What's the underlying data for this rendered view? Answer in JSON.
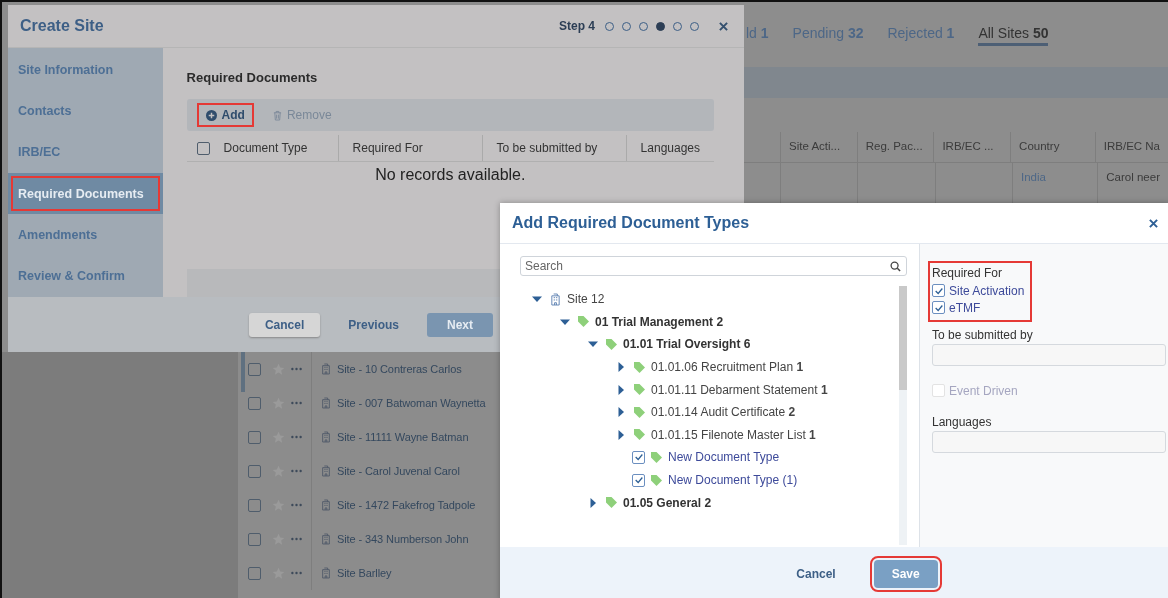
{
  "background_page": {
    "tabs": [
      {
        "label": "ld **1**",
        "selected": false
      },
      {
        "label": "Pending **32**",
        "selected": false
      },
      {
        "label": "Rejected **1**",
        "selected": false
      },
      {
        "label": "All Sites **50**",
        "selected": true
      }
    ],
    "table": {
      "columns": [
        "Site Acti...",
        "Reg. Pac...",
        "IRB/EC ...",
        "Country",
        "IRB/EC Na"
      ],
      "rows": [
        {
          "cells": [
            "",
            "",
            "",
            "India",
            "Carol neer"
          ]
        }
      ]
    },
    "site_list": [
      {
        "name": "Site - 10 Contreras Carlos",
        "checked": false
      },
      {
        "name": "Site - 007 Batwoman Waynetta",
        "checked": false
      },
      {
        "name": "Site - 11111 Wayne Batman",
        "checked": false
      },
      {
        "name": "Site - Carol Juvenal Carol",
        "checked": false
      },
      {
        "name": "Site - 1472 Fakefrog Tadpole",
        "checked": false
      },
      {
        "name": "Site - 343 Numberson John",
        "checked": false
      },
      {
        "name": "Site Barlley",
        "checked": false
      }
    ]
  },
  "create_site": {
    "title": "Create Site",
    "step_label": "Step 4",
    "steps": [
      {
        "selected": false
      },
      {
        "selected": false
      },
      {
        "selected": false
      },
      {
        "selected": true
      },
      {
        "selected": false
      },
      {
        "selected": false
      }
    ],
    "nav": [
      {
        "label": "Site Information",
        "selected": false,
        "highlighted": false
      },
      {
        "label": "Contacts",
        "selected": false,
        "highlighted": false
      },
      {
        "label": "IRB/EC",
        "selected": false,
        "highlighted": false
      },
      {
        "label": "Required Documents",
        "selected": true,
        "highlighted": true
      },
      {
        "label": "Amendments",
        "selected": false,
        "highlighted": false
      },
      {
        "label": "Review & Confirm",
        "selected": false,
        "highlighted": false
      }
    ],
    "section_title": "Required Documents",
    "toolbar": [
      {
        "label": "Add",
        "kind": "add",
        "disabled": false,
        "highlighted": true
      },
      {
        "label": "Remove",
        "kind": "remove",
        "disabled": true,
        "highlighted": false
      }
    ],
    "table": {
      "select_all_checked": false,
      "columns": [
        "Document Type",
        "Required For",
        "To be submitted by",
        "Languages"
      ],
      "empty_message": "No records available."
    },
    "buttons": [
      {
        "label": "Cancel",
        "kind": "secondary"
      },
      {
        "label": "Previous",
        "kind": "link"
      },
      {
        "label": "Next",
        "kind": "primary"
      }
    ]
  },
  "add_dialog": {
    "title": "Add Required Document Types",
    "search": {
      "placeholder": "Search"
    },
    "tree": [
      {
        "label": "Site 12",
        "kind": "site",
        "expanded": true,
        "children": [
          {
            "label": "01 Trial Management 2",
            "kind": "folder",
            "expanded": true,
            "children": [
              {
                "label": "01.01 Trial Oversight 6",
                "kind": "folder",
                "expanded": true,
                "children": [
                  {
                    "label": "01.01.06 Recruitment Plan **1**",
                    "kind": "folder",
                    "expanded": false
                  },
                  {
                    "label": "01.01.11 Debarment Statement **1**",
                    "kind": "folder",
                    "expanded": false
                  },
                  {
                    "label": "01.01.14 Audit Certificate **2**",
                    "kind": "folder",
                    "expanded": false
                  },
                  {
                    "label": "01.01.15 Filenote Master List **1**",
                    "kind": "folder",
                    "expanded": false
                  },
                  {
                    "label": "New Document Type",
                    "kind": "document",
                    "checked": true
                  },
                  {
                    "label": "New Document Type (1)",
                    "kind": "document",
                    "checked": true
                  }
                ]
              },
              {
                "label": "01.05 General **2**",
                "kind": "folder",
                "expanded": false
              }
            ]
          }
        ]
      }
    ],
    "required_for": {
      "label": "Required For",
      "highlighted": true,
      "options": [
        {
          "label": "Site Activation",
          "checked": true
        },
        {
          "label": "eTMF",
          "checked": true
        }
      ]
    },
    "submitted_by": {
      "label": "To be submitted by"
    },
    "event_driven": {
      "label": "Event Driven",
      "checked": false,
      "disabled": true
    },
    "languages": {
      "label": "Languages"
    },
    "buttons": [
      {
        "label": "Cancel",
        "kind": "link",
        "highlighted": false
      },
      {
        "label": "Save",
        "kind": "primary",
        "highlighted": true
      }
    ]
  }
}
